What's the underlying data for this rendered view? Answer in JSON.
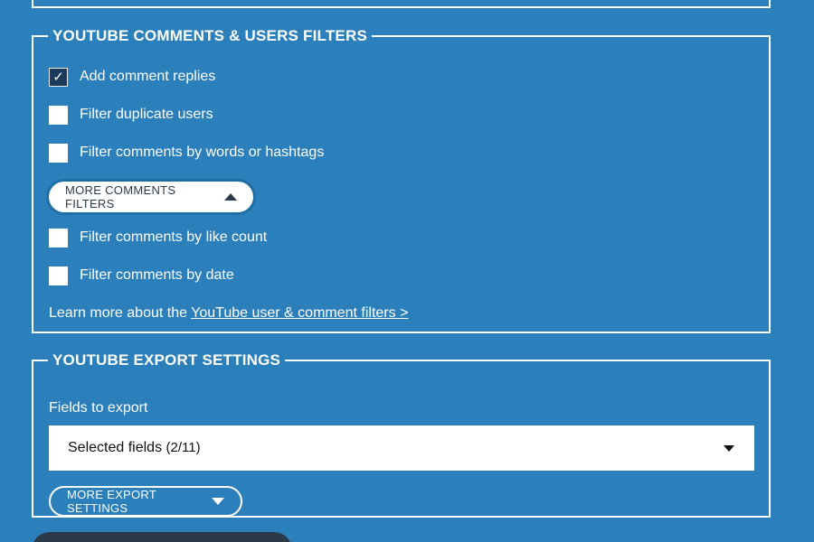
{
  "colors": {
    "background": "#2b7fba",
    "checked_box": "#1d3a5c",
    "bottom_button": "#2b3a4b"
  },
  "comments_section": {
    "title": "YOUTUBE COMMENTS & USERS FILTERS",
    "options": [
      {
        "label": "Add comment replies",
        "checked": true
      },
      {
        "label": "Filter duplicate users",
        "checked": false
      },
      {
        "label": "Filter comments by words or hashtags",
        "checked": false
      }
    ],
    "more_button_label": "MORE COMMENTS FILTERS",
    "more_button_icon": "triangle-up-icon",
    "more_options": [
      {
        "label": "Filter comments by like count",
        "checked": false
      },
      {
        "label": "Filter comments by date",
        "checked": false
      }
    ],
    "learn_prefix": "Learn more about the ",
    "learn_link": "YouTube user & comment filters >"
  },
  "export_section": {
    "title": "YOUTUBE EXPORT SETTINGS",
    "fields_label": "Fields to export",
    "select_value": "Selected fields",
    "select_count": "(2/11)",
    "select_icon": "caret-down-icon",
    "more_button_label": "MORE EXPORT SETTINGS",
    "more_button_icon": "triangle-down-icon"
  }
}
